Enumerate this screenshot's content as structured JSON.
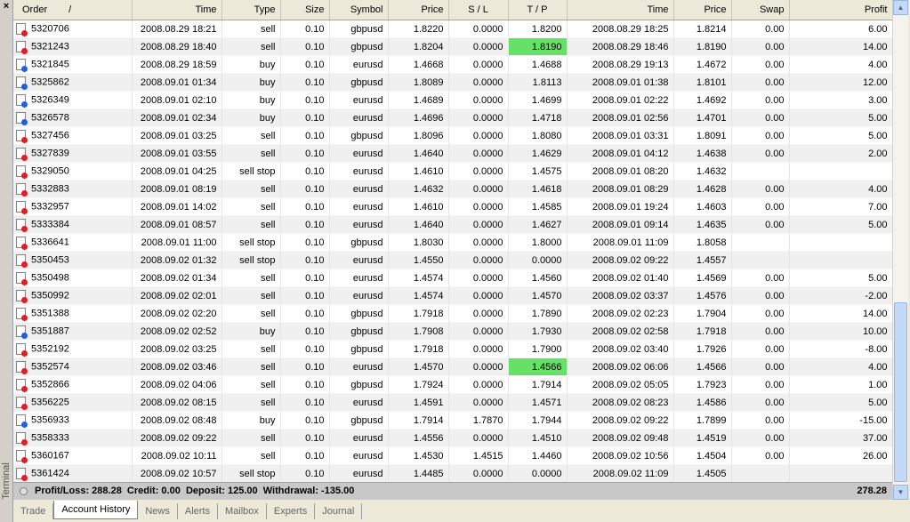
{
  "panel": {
    "side_label": "Terminal",
    "close_glyph": "×"
  },
  "columns": [
    "Order",
    "Time",
    "Type",
    "Size",
    "Symbol",
    "Price",
    "S / L",
    "T / P",
    "Time",
    "Price",
    "Swap",
    "Profit"
  ],
  "sort_glyph": "/",
  "rows": [
    {
      "order": "5320706",
      "open_time": "2008.08.29 18:21",
      "type": "sell",
      "size": "0.10",
      "symbol": "gbpusd",
      "price": "1.8220",
      "sl": "0.0000",
      "tp": "1.8200",
      "close_time": "2008.08.29 18:25",
      "close_price": "1.8214",
      "swap": "0.00",
      "profit": "6.00"
    },
    {
      "order": "5321243",
      "open_time": "2008.08.29 18:40",
      "type": "sell",
      "size": "0.10",
      "symbol": "gbpusd",
      "price": "1.8204",
      "sl": "0.0000",
      "tp": "1.8190",
      "close_time": "2008.08.29 18:46",
      "close_price": "1.8190",
      "swap": "0.00",
      "profit": "14.00",
      "tp_hl": true
    },
    {
      "order": "5321845",
      "open_time": "2008.08.29 18:59",
      "type": "buy",
      "size": "0.10",
      "symbol": "eurusd",
      "price": "1.4668",
      "sl": "0.0000",
      "tp": "1.4688",
      "close_time": "2008.08.29 19:13",
      "close_price": "1.4672",
      "swap": "0.00",
      "profit": "4.00"
    },
    {
      "order": "5325862",
      "open_time": "2008.09.01 01:34",
      "type": "buy",
      "size": "0.10",
      "symbol": "gbpusd",
      "price": "1.8089",
      "sl": "0.0000",
      "tp": "1.8113",
      "close_time": "2008.09.01 01:38",
      "close_price": "1.8101",
      "swap": "0.00",
      "profit": "12.00"
    },
    {
      "order": "5326349",
      "open_time": "2008.09.01 02:10",
      "type": "buy",
      "size": "0.10",
      "symbol": "eurusd",
      "price": "1.4689",
      "sl": "0.0000",
      "tp": "1.4699",
      "close_time": "2008.09.01 02:22",
      "close_price": "1.4692",
      "swap": "0.00",
      "profit": "3.00"
    },
    {
      "order": "5326578",
      "open_time": "2008.09.01 02:34",
      "type": "buy",
      "size": "0.10",
      "symbol": "eurusd",
      "price": "1.4696",
      "sl": "0.0000",
      "tp": "1.4718",
      "close_time": "2008.09.01 02:56",
      "close_price": "1.4701",
      "swap": "0.00",
      "profit": "5.00"
    },
    {
      "order": "5327456",
      "open_time": "2008.09.01 03:25",
      "type": "sell",
      "size": "0.10",
      "symbol": "gbpusd",
      "price": "1.8096",
      "sl": "0.0000",
      "tp": "1.8080",
      "close_time": "2008.09.01 03:31",
      "close_price": "1.8091",
      "swap": "0.00",
      "profit": "5.00"
    },
    {
      "order": "5327839",
      "open_time": "2008.09.01 03:55",
      "type": "sell",
      "size": "0.10",
      "symbol": "eurusd",
      "price": "1.4640",
      "sl": "0.0000",
      "tp": "1.4629",
      "close_time": "2008.09.01 04:12",
      "close_price": "1.4638",
      "swap": "0.00",
      "profit": "2.00"
    },
    {
      "order": "5329050",
      "open_time": "2008.09.01 04:25",
      "type": "sell stop",
      "size": "0.10",
      "symbol": "eurusd",
      "price": "1.4610",
      "sl": "0.0000",
      "tp": "1.4575",
      "close_time": "2008.09.01 08:20",
      "close_price": "1.4632",
      "swap": "",
      "profit": ""
    },
    {
      "order": "5332883",
      "open_time": "2008.09.01 08:19",
      "type": "sell",
      "size": "0.10",
      "symbol": "eurusd",
      "price": "1.4632",
      "sl": "0.0000",
      "tp": "1.4618",
      "close_time": "2008.09.01 08:29",
      "close_price": "1.4628",
      "swap": "0.00",
      "profit": "4.00"
    },
    {
      "order": "5332957",
      "open_time": "2008.09.01 14:02",
      "type": "sell",
      "size": "0.10",
      "symbol": "eurusd",
      "price": "1.4610",
      "sl": "0.0000",
      "tp": "1.4585",
      "close_time": "2008.09.01 19:24",
      "close_price": "1.4603",
      "swap": "0.00",
      "profit": "7.00"
    },
    {
      "order": "5333384",
      "open_time": "2008.09.01 08:57",
      "type": "sell",
      "size": "0.10",
      "symbol": "eurusd",
      "price": "1.4640",
      "sl": "0.0000",
      "tp": "1.4627",
      "close_time": "2008.09.01 09:14",
      "close_price": "1.4635",
      "swap": "0.00",
      "profit": "5.00"
    },
    {
      "order": "5336641",
      "open_time": "2008.09.01 11:00",
      "type": "sell stop",
      "size": "0.10",
      "symbol": "gbpusd",
      "price": "1.8030",
      "sl": "0.0000",
      "tp": "1.8000",
      "close_time": "2008.09.01 11:09",
      "close_price": "1.8058",
      "swap": "",
      "profit": ""
    },
    {
      "order": "5350453",
      "open_time": "2008.09.02 01:32",
      "type": "sell stop",
      "size": "0.10",
      "symbol": "eurusd",
      "price": "1.4550",
      "sl": "0.0000",
      "tp": "0.0000",
      "close_time": "2008.09.02 09:22",
      "close_price": "1.4557",
      "swap": "",
      "profit": ""
    },
    {
      "order": "5350498",
      "open_time": "2008.09.02 01:34",
      "type": "sell",
      "size": "0.10",
      "symbol": "eurusd",
      "price": "1.4574",
      "sl": "0.0000",
      "tp": "1.4560",
      "close_time": "2008.09.02 01:40",
      "close_price": "1.4569",
      "swap": "0.00",
      "profit": "5.00"
    },
    {
      "order": "5350992",
      "open_time": "2008.09.02 02:01",
      "type": "sell",
      "size": "0.10",
      "symbol": "eurusd",
      "price": "1.4574",
      "sl": "0.0000",
      "tp": "1.4570",
      "close_time": "2008.09.02 03:37",
      "close_price": "1.4576",
      "swap": "0.00",
      "profit": "-2.00"
    },
    {
      "order": "5351388",
      "open_time": "2008.09.02 02:20",
      "type": "sell",
      "size": "0.10",
      "symbol": "gbpusd",
      "price": "1.7918",
      "sl": "0.0000",
      "tp": "1.7890",
      "close_time": "2008.09.02 02:23",
      "close_price": "1.7904",
      "swap": "0.00",
      "profit": "14.00"
    },
    {
      "order": "5351887",
      "open_time": "2008.09.02 02:52",
      "type": "buy",
      "size": "0.10",
      "symbol": "gbpusd",
      "price": "1.7908",
      "sl": "0.0000",
      "tp": "1.7930",
      "close_time": "2008.09.02 02:58",
      "close_price": "1.7918",
      "swap": "0.00",
      "profit": "10.00"
    },
    {
      "order": "5352192",
      "open_time": "2008.09.02 03:25",
      "type": "sell",
      "size": "0.10",
      "symbol": "gbpusd",
      "price": "1.7918",
      "sl": "0.0000",
      "tp": "1.7900",
      "close_time": "2008.09.02 03:40",
      "close_price": "1.7926",
      "swap": "0.00",
      "profit": "-8.00"
    },
    {
      "order": "5352574",
      "open_time": "2008.09.02 03:46",
      "type": "sell",
      "size": "0.10",
      "symbol": "eurusd",
      "price": "1.4570",
      "sl": "0.0000",
      "tp": "1.4566",
      "close_time": "2008.09.02 06:06",
      "close_price": "1.4566",
      "swap": "0.00",
      "profit": "4.00",
      "tp_hl": true
    },
    {
      "order": "5352866",
      "open_time": "2008.09.02 04:06",
      "type": "sell",
      "size": "0.10",
      "symbol": "gbpusd",
      "price": "1.7924",
      "sl": "0.0000",
      "tp": "1.7914",
      "close_time": "2008.09.02 05:05",
      "close_price": "1.7923",
      "swap": "0.00",
      "profit": "1.00"
    },
    {
      "order": "5356225",
      "open_time": "2008.09.02 08:15",
      "type": "sell",
      "size": "0.10",
      "symbol": "eurusd",
      "price": "1.4591",
      "sl": "0.0000",
      "tp": "1.4571",
      "close_time": "2008.09.02 08:23",
      "close_price": "1.4586",
      "swap": "0.00",
      "profit": "5.00"
    },
    {
      "order": "5356933",
      "open_time": "2008.09.02 08:48",
      "type": "buy",
      "size": "0.10",
      "symbol": "gbpusd",
      "price": "1.7914",
      "sl": "1.7870",
      "tp": "1.7944",
      "close_time": "2008.09.02 09:22",
      "close_price": "1.7899",
      "swap": "0.00",
      "profit": "-15.00"
    },
    {
      "order": "5358333",
      "open_time": "2008.09.02 09:22",
      "type": "sell",
      "size": "0.10",
      "symbol": "eurusd",
      "price": "1.4556",
      "sl": "0.0000",
      "tp": "1.4510",
      "close_time": "2008.09.02 09:48",
      "close_price": "1.4519",
      "swap": "0.00",
      "profit": "37.00"
    },
    {
      "order": "5360167",
      "open_time": "2008.09.02 10:11",
      "type": "sell",
      "size": "0.10",
      "symbol": "eurusd",
      "price": "1.4530",
      "sl": "1.4515",
      "tp": "1.4460",
      "close_time": "2008.09.02 10:56",
      "close_price": "1.4504",
      "swap": "0.00",
      "profit": "26.00"
    },
    {
      "order": "5361424",
      "open_time": "2008.09.02 10:57",
      "type": "sell stop",
      "size": "0.10",
      "symbol": "eurusd",
      "price": "1.4485",
      "sl": "0.0000",
      "tp": "0.0000",
      "close_time": "2008.09.02 11:09",
      "close_price": "1.4505",
      "swap": "",
      "profit": ""
    }
  ],
  "summary": {
    "text": "Profit/Loss: 288.28  Credit: 0.00  Deposit: 125.00  Withdrawal: -135.00",
    "total": "278.28"
  },
  "scrollbar": {
    "up_glyph": "▲",
    "down_glyph": "▼"
  },
  "tabs": [
    {
      "label": "Trade",
      "active": false
    },
    {
      "label": "Account History",
      "active": true
    },
    {
      "label": "News",
      "active": false
    },
    {
      "label": "Alerts",
      "active": false
    },
    {
      "label": "Mailbox",
      "active": false
    },
    {
      "label": "Experts",
      "active": false
    },
    {
      "label": "Journal",
      "active": false
    }
  ]
}
